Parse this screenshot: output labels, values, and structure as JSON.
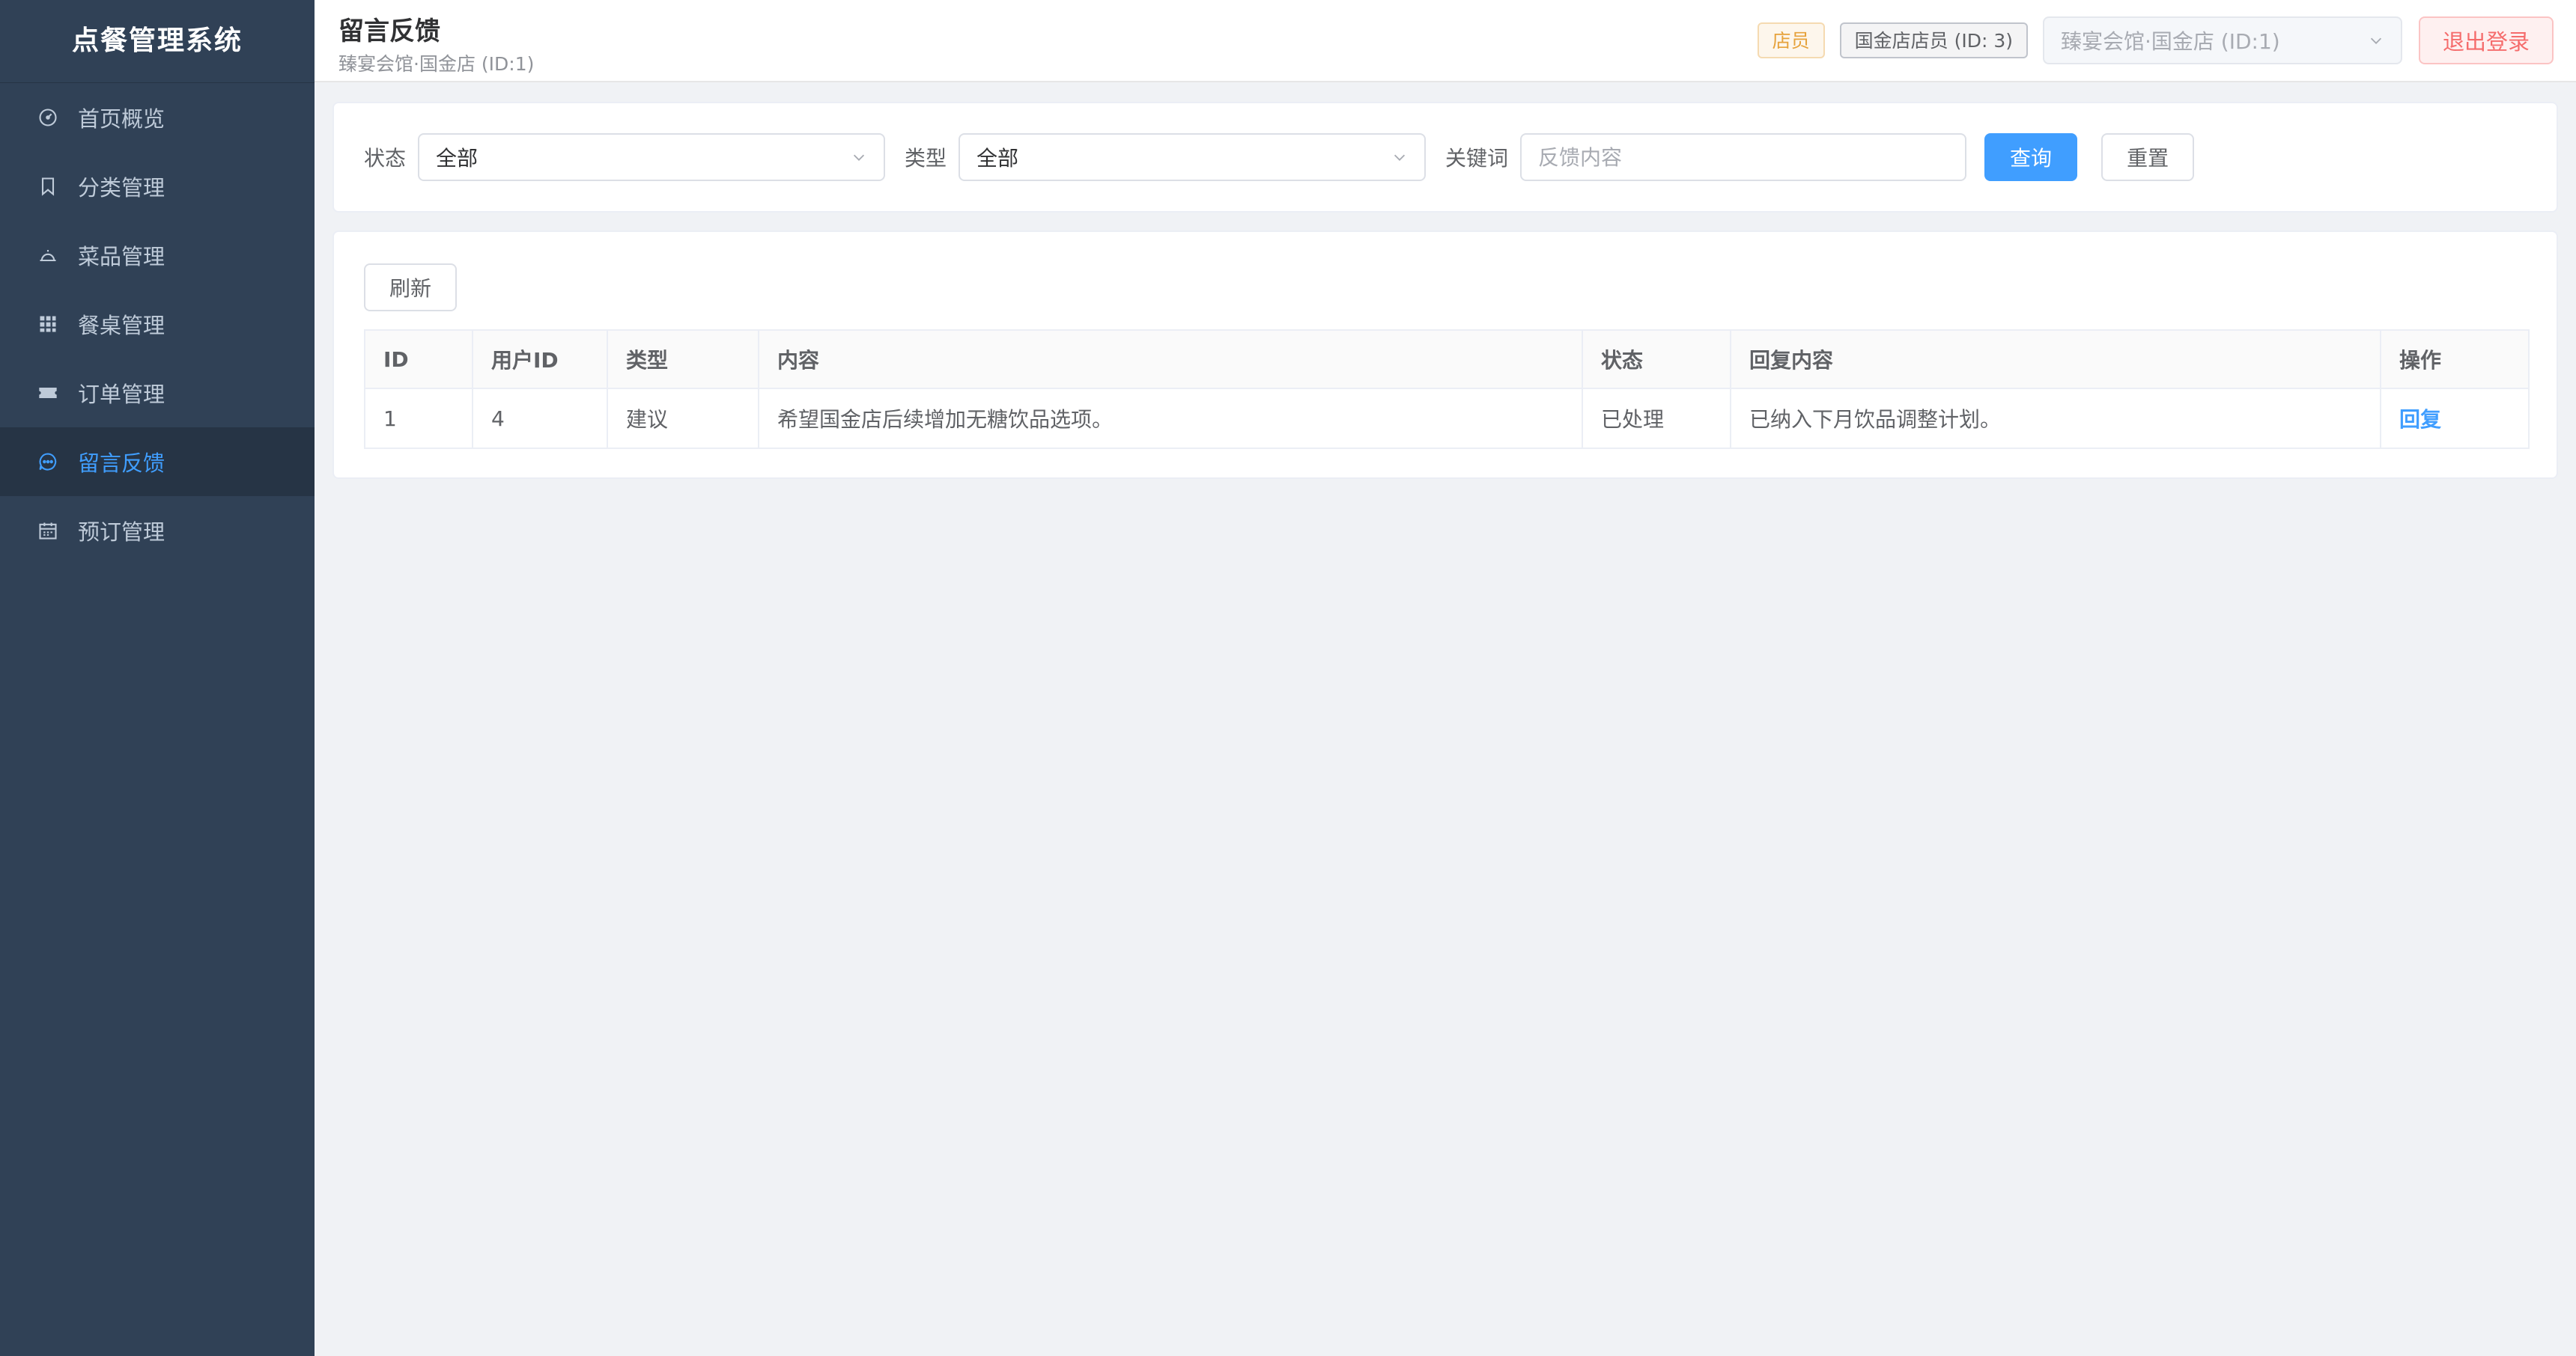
{
  "app": {
    "brand": "点餐管理系统"
  },
  "sidebar": {
    "items": [
      {
        "label": "首页概览",
        "icon": "dashboard-icon"
      },
      {
        "label": "分类管理",
        "icon": "bookmark-icon"
      },
      {
        "label": "菜品管理",
        "icon": "dish-cover-icon"
      },
      {
        "label": "餐桌管理",
        "icon": "grid-icon"
      },
      {
        "label": "订单管理",
        "icon": "ticket-icon"
      },
      {
        "label": "留言反馈",
        "icon": "chat-bubble-icon",
        "active": true
      },
      {
        "label": "预订管理",
        "icon": "calendar-icon"
      }
    ]
  },
  "header": {
    "title": "留言反馈",
    "subtitle": "臻宴会馆·国金店 (ID:1)",
    "role_tag": "店员",
    "user_tag": "国金店店员 (ID: 3)",
    "store_select": "臻宴会馆·国金店 (ID:1)",
    "logout_label": "退出登录"
  },
  "filters": {
    "status_label": "状态",
    "status_value": "全部",
    "type_label": "类型",
    "type_value": "全部",
    "keyword_label": "关键词",
    "keyword_placeholder": "反馈内容",
    "keyword_value": "",
    "query_label": "查询",
    "reset_label": "重置"
  },
  "table": {
    "refresh_label": "刷新",
    "columns": [
      "ID",
      "用户ID",
      "类型",
      "内容",
      "状态",
      "回复内容",
      "操作"
    ],
    "rows": [
      {
        "id": "1",
        "user_id": "4",
        "type": "建议",
        "content": "希望国金店后续增加无糖饮品选项。",
        "status": "已处理",
        "reply": "已纳入下月饮品调整计划。",
        "action": "回复"
      }
    ]
  },
  "colors": {
    "sidebar_bg": "#304156",
    "accent": "#409eff",
    "danger": "#f56c6c",
    "warning": "#e6a23c"
  }
}
